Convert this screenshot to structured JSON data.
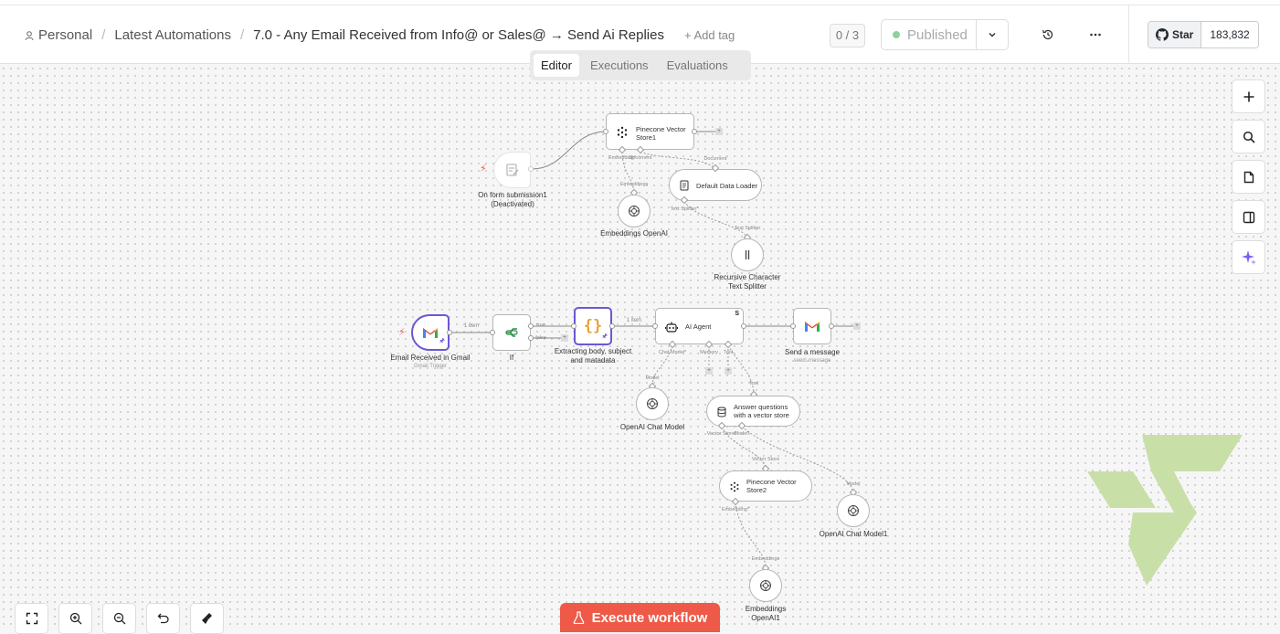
{
  "breadcrumb": {
    "project": "Personal",
    "folder": "Latest Automations",
    "workflow_title": "7.0 - Any Email Received from Info@ or Sales@ → Send Ai Replies",
    "add_tag": "+ Add tag"
  },
  "header": {
    "counter": "0 / 3",
    "status": "Published",
    "status_color": "#8fd19e",
    "github_star": "Star",
    "github_count": "183,832"
  },
  "tabs": [
    "Editor",
    "Executions",
    "Evaluations"
  ],
  "active_tab": "Editor",
  "nodes": {
    "pinecone1": "Pinecone Vector Store1",
    "form": "On form submission1",
    "form_sub": "(Deactivated)",
    "loader": "Default Data Loader",
    "emb_openai": "Embeddings OpenAI",
    "splitter": "Recursive Character Text Splitter",
    "gmail_trigger": "Email Received in Gmail",
    "gmail_trigger_sub": "Gmail Trigger",
    "if": "If",
    "extract": "Extracting body, subject and matadata",
    "agent": "AI Agent",
    "send": "Send a message",
    "send_sub": "send: message",
    "chat_model": "OpenAI Chat Model",
    "answer": "Answer questions with a vector store",
    "pinecone2": "Pinecone Vector Store2",
    "chat_model1": "OpenAI Chat Model1",
    "emb_openai1": "Embeddings OpenAI1"
  },
  "ports": {
    "embedding_req": "Embedding*",
    "document": "Document",
    "embeddings": "Embeddings",
    "text_splitter_req": "Text Splitter*",
    "text_splitter": "Text Splitter",
    "chat_model_req": "Chat Model*",
    "memory": "Memory",
    "tool": "Tool",
    "model": "Model",
    "vector_store_req": "Vector Store*",
    "model_req": "Model*",
    "vector_store": "Vector Store",
    "true": "true",
    "false": "false"
  },
  "edge_labels": {
    "gmail_to_if": "1 item",
    "extract_to_agent": "1 item"
  },
  "execute_button": "Execute workflow",
  "colors": {
    "accent": "#ee5a47",
    "selected_node": "#6b59d3",
    "watermark": "#c9dfa8"
  }
}
